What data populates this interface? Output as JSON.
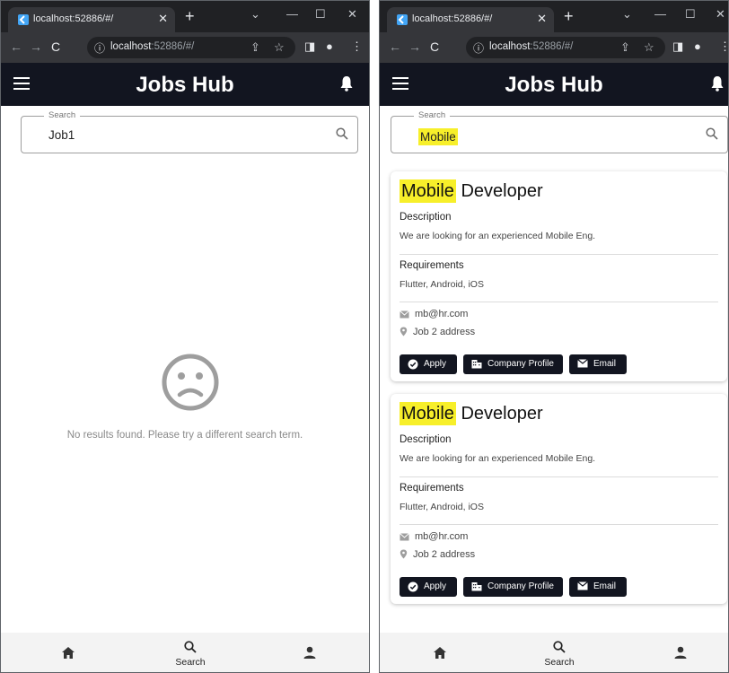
{
  "browser": {
    "tab_title": "localhost:52886/#/",
    "url_host": "localhost",
    "url_rest": ":52886/#/"
  },
  "app": {
    "title": "Jobs Hub"
  },
  "colors": {
    "appbar": "#121520",
    "highlight": "#f7ef2a",
    "button": "#121520"
  },
  "left_screen": {
    "search": {
      "label": "Search",
      "value": "Job1"
    },
    "empty_message": "No results found. Please try a different search term."
  },
  "right_screen": {
    "search": {
      "label": "Search",
      "value": "Mobile"
    },
    "jobs": [
      {
        "title_highlight": "Mobile",
        "title_rest": " Developer",
        "description_label": "Description",
        "description": "We are looking for an experienced Mobile Eng.",
        "requirements_label": "Requirements",
        "requirements": "Flutter, Android, iOS",
        "email": "mb@hr.com",
        "address": "Job 2 address",
        "buttons": {
          "apply": "Apply",
          "company": "Company Profile",
          "email": "Email"
        }
      },
      {
        "title_highlight": "Mobile",
        "title_rest": " Developer",
        "description_label": "Description",
        "description": "We are looking for an experienced Mobile Eng.",
        "requirements_label": "Requirements",
        "requirements": "Flutter, Android, iOS",
        "email": "mb@hr.com",
        "address": "Job 2 address",
        "buttons": {
          "apply": "Apply",
          "company": "Company Profile",
          "email": "Email"
        }
      }
    ]
  },
  "bottom_nav": {
    "items": [
      {
        "icon": "home-icon",
        "label": ""
      },
      {
        "icon": "search-icon",
        "label": "Search"
      },
      {
        "icon": "person-icon",
        "label": ""
      }
    ]
  }
}
